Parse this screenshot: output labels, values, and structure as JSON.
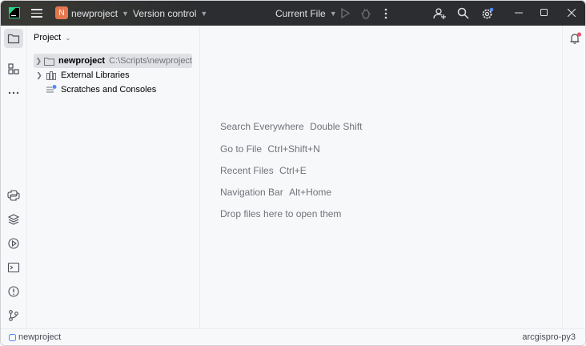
{
  "titlebar": {
    "project_badge": "N",
    "project_name": "newproject",
    "vcs_label": "Version control",
    "run_config": "Current File",
    "icons": [
      "app-logo-icon",
      "hamburger-menu-icon",
      "run-icon",
      "debug-icon",
      "more-vertical-icon",
      "add-user-icon",
      "search-icon",
      "settings-icon",
      "minimize-icon",
      "maximize-icon",
      "close-icon"
    ]
  },
  "toolstrip": {
    "top": [
      "folder-icon",
      "structure-icon",
      "more-horizontal-icon"
    ],
    "bottom": [
      "python-console-icon",
      "layers-icon",
      "services-icon",
      "terminal-icon",
      "problems-icon",
      "git-icon"
    ]
  },
  "project_panel": {
    "title": "Project",
    "tree": [
      {
        "label": "newproject",
        "path": "C:\\Scripts\\newproject",
        "icon": "folder-icon"
      },
      {
        "label": "External Libraries",
        "icon": "library-icon"
      },
      {
        "label": "Scratches and Consoles",
        "icon": "scratches-icon"
      }
    ]
  },
  "editor": {
    "hints": [
      {
        "action": "Search Everywhere",
        "shortcut": "Double Shift"
      },
      {
        "action": "Go to File",
        "shortcut": "Ctrl+Shift+N"
      },
      {
        "action": "Recent Files",
        "shortcut": "Ctrl+E"
      },
      {
        "action": "Navigation Bar",
        "shortcut": "Alt+Home"
      },
      {
        "action": "Drop files here to open them",
        "shortcut": ""
      }
    ]
  },
  "statusbar": {
    "breadcrumb": "newproject",
    "interpreter": "arcgispro-py3"
  },
  "colors": {
    "titlebar_bg": "#2b2d30",
    "project_badge": "#e4774f",
    "notification_dot": "#e55765",
    "settings_dot": "#548af7"
  }
}
